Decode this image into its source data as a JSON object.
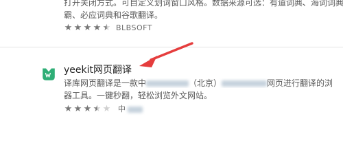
{
  "ext_previous": {
    "desc_line1": "打开关闭方式。可自定义划词窗口风格。数据来源可选：有道词典、海词词典、金山词",
    "desc_line2": "霸、必应词典和谷歌翻译。",
    "rating": 4.5,
    "developer": "BLBSOFT"
  },
  "ext_yeekit": {
    "name": "yeekit网页翻译",
    "desc_line1_start": "译库网页翻译是一款中",
    "desc_line1_mid": "（北京）",
    "desc_line1_mid2": "网页进行翻译的浏",
    "desc_line2": "器工具。一键秒翻，轻松浏览外文网站。",
    "rating": 3.5,
    "developer": "中",
    "logo_color": "#2eae76"
  },
  "annotation": {
    "arrow_color": "#e53d3d"
  },
  "colors": {
    "text": "#595959",
    "title": "#1f1f1f",
    "star": "#777777",
    "star_empty": "#cfcfcf"
  }
}
